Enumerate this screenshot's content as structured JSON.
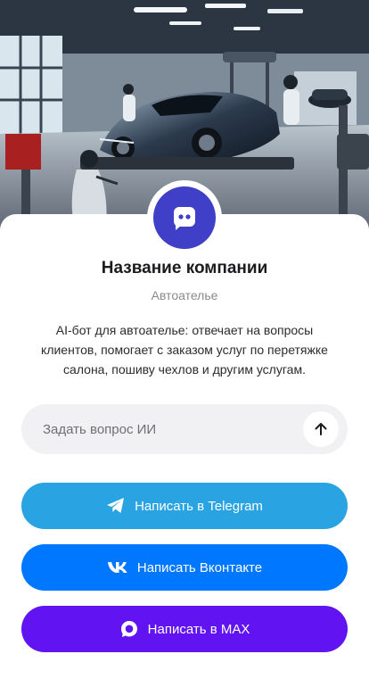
{
  "hero": {
    "image_alt": "auto-atelier-workshop-illustration"
  },
  "company": {
    "name": "Название компании",
    "category": "Автоателье",
    "description": "AI-бот для автоателье: отвечает на вопросы клиентов, помогает с заказом услуг по перетяжке салона, пошиву чехлов и другим услугам.",
    "avatar_icon": "chat-bubble-icon",
    "avatar_color": "#3f3fc7"
  },
  "ask": {
    "placeholder": "Задать вопрос ИИ",
    "value": "",
    "send_icon": "arrow-up-icon"
  },
  "actions": [
    {
      "label": "Написать в Telegram",
      "icon": "telegram-icon",
      "color": "#2aa3e3"
    },
    {
      "label": "Написать Вконтакте",
      "icon": "vk-icon",
      "color": "#0077ff"
    },
    {
      "label": "Написать в MAX",
      "icon": "max-icon",
      "color": "#6213f2"
    }
  ]
}
